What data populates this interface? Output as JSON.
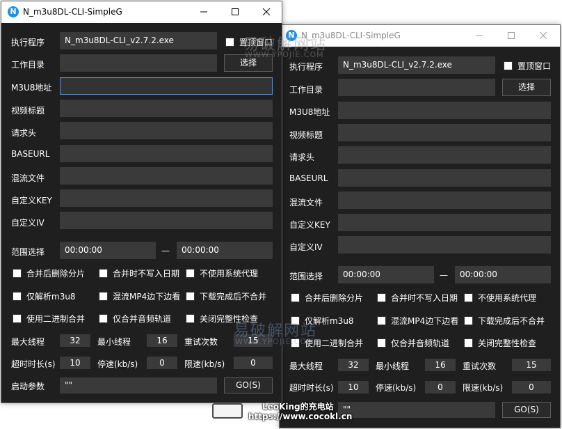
{
  "colors": {
    "window_bg": "#1f1f1f",
    "field_bg": "#3a3a3a",
    "focus_border": "#5a8ed0",
    "titlebar_bg": "#ffffff",
    "app_icon": "#1e8fe8"
  },
  "window_a": {
    "title": "N_m3u8DL-CLI-SimpleG",
    "icon_letter": "N",
    "labels": {
      "exe": "执行程序",
      "workdir": "工作目录",
      "m3u8": "M3U8地址",
      "video_title": "视频标题",
      "headers": "请求头",
      "baseurl": "BASEURL",
      "mux": "混流文件",
      "key": "自定义KEY",
      "iv": "自定义IV",
      "range": "范围选择",
      "max_thread": "最大线程",
      "min_thread": "最小线程",
      "retry": "重试次数",
      "timeout": "超时时长(s)",
      "stop_speed": "停速(kb/s)",
      "limit_speed": "限速(kb/s)",
      "start_args": "启动参数"
    },
    "values": {
      "exe": "N_m3u8DL-CLI_v2.7.2.exe",
      "workdir": "",
      "m3u8": "",
      "video_title": "",
      "headers": "",
      "baseurl": "",
      "mux": "",
      "key": "",
      "iv": "",
      "range_start": "00:00:00",
      "range_end": "00:00:00",
      "range_sep": "—",
      "max_thread": "32",
      "min_thread": "16",
      "retry": "15",
      "timeout": "10",
      "stop_speed": "0",
      "limit_speed": "0",
      "start_args": "\"\""
    },
    "topmost_label": "置顶窗口",
    "choose_button": "选择",
    "go_button": "GO(S)",
    "checkboxes": [
      "合并后删除分片",
      "合并时不写入日期",
      "不使用系统代理",
      "仅解析m3u8",
      "混流MP4边下边看",
      "下载完成后不合并",
      "使用二进制合并",
      "仅合并音频轨道",
      "关闭完整性检查"
    ]
  },
  "window_b": {
    "title": "N_m3u8DL-CLI-SimpleG",
    "icon_letter": "N",
    "labels": {
      "exe": "执行程序",
      "workdir": "工作目录",
      "m3u8": "M3U8地址",
      "video_title": "视频标题",
      "headers": "请求头",
      "baseurl": "BASEURL",
      "mux": "混流文件",
      "key": "自定义KEY",
      "iv": "自定义IV",
      "range": "范围选择",
      "max_thread": "最大线程",
      "min_thread": "最小线程",
      "retry": "重试次数",
      "timeout": "超时时长(s)",
      "stop_speed": "停速(kb/s)",
      "limit_speed": "限速(kb/s)"
    },
    "values": {
      "exe": "N_m3u8DL-CLI_v2.7.2.exe",
      "workdir": "",
      "m3u8": "",
      "video_title": "",
      "headers": "",
      "baseurl": "",
      "mux": "",
      "key": "",
      "iv": "",
      "range_start": "00:00:00",
      "range_end": "00:00:00",
      "range_sep": "—",
      "max_thread": "32",
      "min_thread": "16",
      "retry": "15",
      "timeout": "10",
      "stop_speed": "0",
      "limit_speed": "0",
      "start_args": "\"\""
    },
    "topmost_label": "置顶窗口",
    "choose_button": "选择",
    "go_button": "GO(S)",
    "checkboxes": [
      "合并后删除分片",
      "合并时不写入日期",
      "不使用系统代理",
      "仅解析m3u8",
      "混流MP4边下边看",
      "下载完成后不合并",
      "使用二进制合并",
      "仅合并音频轨道",
      "关闭完整性检查"
    ]
  },
  "watermarks": {
    "cn_top": "易破解网站",
    "url_top": "WWW.YPOJIE.COM",
    "cn_mid": "易破解网站",
    "url_mid": "WWW.YPOJIE.COM"
  },
  "badge": {
    "name": "LeoKing的充电站",
    "url": "https://www.cocokl.cn"
  }
}
